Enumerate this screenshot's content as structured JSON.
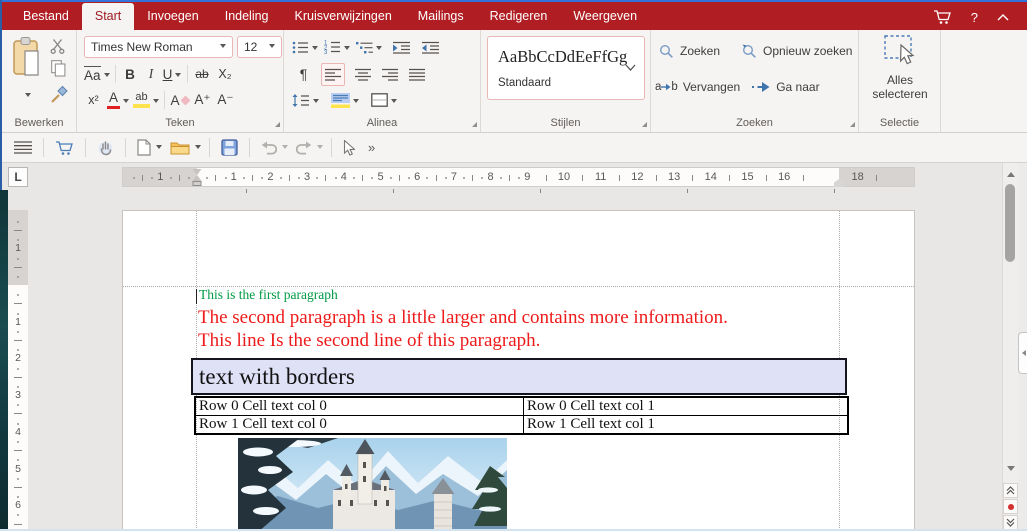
{
  "titlebar": {
    "tabs": [
      {
        "label": "Bestand"
      },
      {
        "label": "Start"
      },
      {
        "label": "Invoegen"
      },
      {
        "label": "Indeling"
      },
      {
        "label": "Kruisverwijzingen"
      },
      {
        "label": "Mailings"
      },
      {
        "label": "Redigeren"
      },
      {
        "label": "Weergeven"
      }
    ],
    "active_tab": "Start",
    "help_glyph": "?"
  },
  "ribbon": {
    "bewerken": {
      "label": "Bewerken"
    },
    "teken": {
      "label": "Teken",
      "font_name": "Times New Roman",
      "font_size": "12",
      "case_btn": "Aa",
      "bold": "B",
      "italic": "I",
      "underline": "U",
      "strikethrough": "ab",
      "subscript": "X₂",
      "superscript": "x²",
      "font_color": "A",
      "highlight": "ab",
      "clear_format": "A",
      "grow_font": "A⁺",
      "shrink_font": "A⁻"
    },
    "alinea": {
      "label": "Alinea",
      "pilcrow": "¶"
    },
    "stijlen": {
      "label": "Stijlen",
      "preview": "AaBbCcDdEeFfGg",
      "style_name": "Standaard"
    },
    "zoeken": {
      "label": "Zoeken",
      "find": "Zoeken",
      "find_next": "Opnieuw zoeken",
      "replace": "Vervangen",
      "replace_a": "a",
      "replace_b": "b",
      "goto": "Ga naar"
    },
    "selectie": {
      "label": "Selectie",
      "select_all_1": "Alles",
      "select_all_2": "selecteren"
    }
  },
  "quickbar": {
    "more_glyph": "»"
  },
  "ruler": {
    "tab_selector": "L",
    "h_margin_number": "1",
    "h_numbers": [
      "1",
      "2",
      "3",
      "4",
      "5",
      "6",
      "7",
      "8",
      "9",
      "10",
      "11",
      "12",
      "13",
      "14",
      "15",
      "16"
    ],
    "h_right_number": "18",
    "v_margin_number": "1",
    "v_numbers": [
      "1",
      "2",
      "3",
      "4",
      "5",
      "6"
    ]
  },
  "document": {
    "paragraph1": {
      "text": "This is the first paragraph",
      "color": "#009a44"
    },
    "paragraph2": {
      "line1": "The second paragraph is a little larger and contains more information.",
      "line2": "This line Is the second line of this paragraph.",
      "color": "#ef1a1a"
    },
    "bordered_box": {
      "text": "text with borders",
      "background": "#dfe1f6"
    },
    "table": {
      "rows": [
        [
          "Row 0 Cell text col 0",
          "Row 0 Cell text col 1"
        ],
        [
          "Row 1 Cell text col 0",
          "Row 1 Cell text col 1"
        ]
      ]
    },
    "image": {
      "description": "winter castle with snowy mountains"
    }
  },
  "colors": {
    "titlebar_red": "#b01e23",
    "window_border_blue": "#3272d9",
    "accent_blue": "#3f74ad",
    "control_border_pink": "#eab6b4",
    "doc_green": "#009a44",
    "doc_red": "#ef1a1a",
    "box_lavender": "#dfe1f6",
    "highlight_yellow": "#ffe34d"
  }
}
